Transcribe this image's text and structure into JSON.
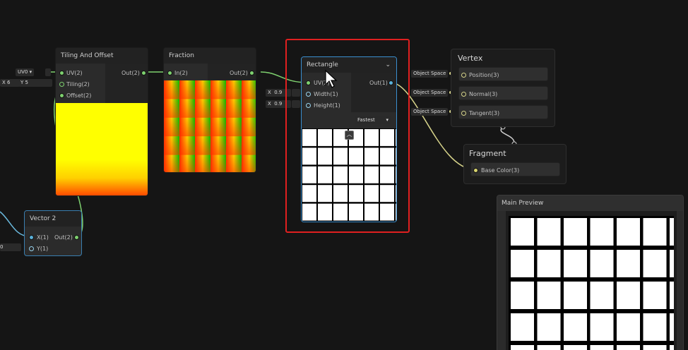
{
  "nodes": {
    "tiling": {
      "title": "Tiling And Offset",
      "in_uv": "UV(2)",
      "in_tiling": "Tiling(2)",
      "in_offset": "Offset(2)",
      "out": "Out(2)",
      "uv_dropdown": "UV0",
      "tiling_x_label": "X",
      "tiling_x": "6",
      "tiling_y_label": "Y",
      "tiling_y": "5"
    },
    "fraction": {
      "title": "Fraction",
      "in": "In(2)",
      "out": "Out(2)"
    },
    "rectangle": {
      "title": "Rectangle",
      "in_uv": "UV(2)",
      "in_width": "Width(1)",
      "in_height": "Height(1)",
      "out": "Out(1)",
      "width_x_label": "X",
      "width_x": "0.9",
      "height_x_label": "X",
      "height_x": "0.9",
      "mode": "Fastest",
      "chevron": "⌄"
    },
    "vector2": {
      "title": "Vector 2",
      "in_x": "X(1)",
      "in_y": "Y(1)",
      "out": "Out(2)",
      "y_value": "0"
    }
  },
  "stack": {
    "vertex_title": "Vertex",
    "fragment_title": "Fragment",
    "position": "Position(3)",
    "normal": "Normal(3)",
    "tangent": "Tangent(3)",
    "base_color": "Base Color(3)",
    "object_space_1": "Object Space",
    "object_space_2": "Object Space",
    "object_space_3": "Object Space"
  },
  "preview": {
    "title": "Main Preview"
  },
  "colors": {
    "highlight": "#e02020",
    "wire_green": "#7ed16f",
    "wire_blue": "#6ab8dc",
    "wire_yellow": "#d6d38a",
    "selection": "#3a8fd0"
  },
  "icons": {
    "cursor": "cursor-icon",
    "collapse": "collapse-arrow-icon"
  }
}
